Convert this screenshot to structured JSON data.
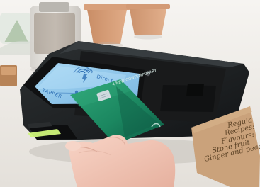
{
  "scene": {
    "subject": "contactless card payment terminal on a countertop",
    "colors": {
      "background": "#f4f2ee",
      "terminal_body": "#1f2224",
      "terminal_screen": "#8fc5ea",
      "card_green": "#1f8f67",
      "card_dark": "#0f5f47",
      "kraft_note": "#c9a27a",
      "accent_light": "#c7f06b"
    }
  },
  "terminal": {
    "screen_brand_text": "Direct",
    "screen_tagline": "TAPPER"
  },
  "card": {
    "brand_text": "4 NEW CONTEMPORARY"
  },
  "note": {
    "lines": [
      "Regula",
      "Recipes:",
      "Flavours:",
      "Stone fruit",
      "Ginger and peach"
    ]
  },
  "icons": {
    "contactless_symbol": "contactless-icon"
  }
}
